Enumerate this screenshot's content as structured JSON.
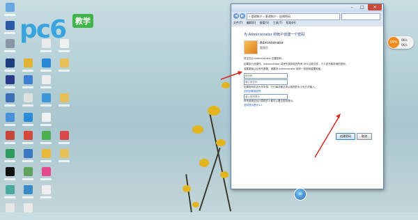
{
  "watermark": {
    "logo": "pc6",
    "badge": "教学"
  },
  "window": {
    "address": "« 管理帐户 › 更改帐户 › 创建密码",
    "menu": [
      "文件(F)",
      "编辑(E)",
      "查看(V)",
      "工具(T)",
      "帮助(H)"
    ],
    "controls": {
      "min": "–",
      "max": "□",
      "close": "✕"
    }
  },
  "dialog": {
    "heading": "为 Administrator 的帐户创建一个密码",
    "user_name": "Administrator",
    "user_role": "管理员",
    "intro": "您正在为 Administrator 创建密码。",
    "warning_1": "如果执行此操作，Administrator 将丢失其网站的所有 EFS 加密文件、个人证书和存储的密码。",
    "warning_2": "若要避免以后丢失数据，请要求 Administrator 制作一张密码重置软盘。",
    "new_password_placeholder": "新密码",
    "confirm_password_placeholder": "确认新密码",
    "case_hint": "如果密码包含大写字母，它们每次都必须以相同的大小写方式输入。",
    "strong_password_link": "如何创建强密码",
    "hint_label": "键入密码提示",
    "hint_note": "所有使用这台计算机的人都可以看见密码提示。",
    "hint_link": "密码提示是什么?",
    "create_button": "创建密码",
    "cancel_button": "取消"
  },
  "widget": {
    "ball": "59%",
    "line1": "0K/s",
    "line2": "0K/s"
  },
  "taskbar": {
    "orb": "00"
  },
  "colors": {
    "accent_link": "#1a5fb4",
    "arrow": "#d42a22",
    "flower": "#e2b51e",
    "close_button": "#c74a3c"
  }
}
